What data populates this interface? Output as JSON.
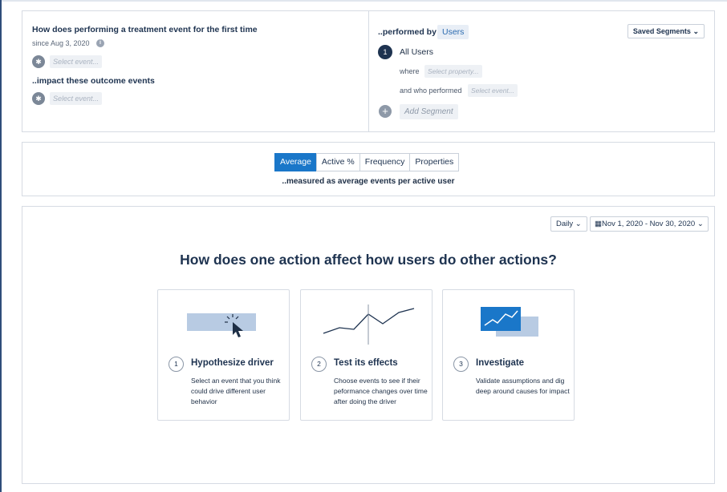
{
  "query": {
    "treatment_title": "How does performing a treatment event for the first time",
    "since": "since Aug 3, 2020",
    "treatment_placeholder": "Select event...",
    "impact_title": "..impact these outcome events",
    "outcome_placeholder": "Select event..."
  },
  "segments": {
    "performed_by_label": "..performed by",
    "users_label": "Users",
    "saved_segments_label": "Saved Segments",
    "segment_number": "1",
    "segment_name": "All Users",
    "where_label": "where",
    "property_placeholder": "Select property...",
    "who_performed_label": "and who performed",
    "event_placeholder": "Select event...",
    "add_segment_label": "Add Segment"
  },
  "measure": {
    "tabs": [
      "Average",
      "Active %",
      "Frequency",
      "Properties"
    ],
    "active_tab": "Average",
    "description": "..measured as average events per active user"
  },
  "controls": {
    "interval_label": "Daily",
    "date_range_label": "Nov 1, 2020 - Nov 30, 2020"
  },
  "onboarding": {
    "headline": "How does one action affect how users do other actions?",
    "steps": [
      {
        "number": "1",
        "title": "Hypothesize driver",
        "description": "Select an event that you think could drive different user behavior"
      },
      {
        "number": "2",
        "title": "Test its effects",
        "description": "Choose events to see if their peformance changes over time after doing the driver"
      },
      {
        "number": "3",
        "title": "Investigate",
        "description": "Validate assumptions and dig deep around causes for impact"
      }
    ]
  },
  "colors": {
    "accent": "#1a77c9",
    "navy": "#1e3350",
    "light_blue": "#b8cbe3"
  }
}
